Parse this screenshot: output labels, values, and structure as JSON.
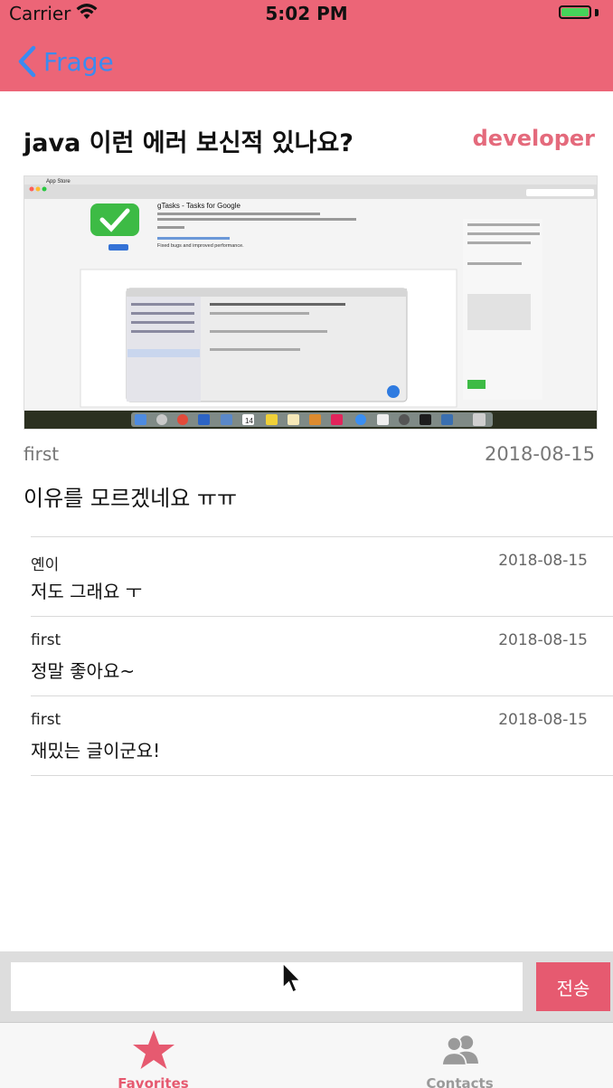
{
  "status_bar": {
    "carrier": "Carrier",
    "time": "5:02 PM",
    "battery_level": 1.0
  },
  "nav": {
    "back_label": "Frage"
  },
  "post": {
    "title": "java 이런 에러 보신적 있나요?",
    "badge": "developer",
    "author": "first",
    "date": "2018-08-15",
    "body": "이유를 모르겠네요 ㅠㅠ"
  },
  "screenshot": {
    "menubar_app": "App Store",
    "app_title": "gTasks - Tasks for Google",
    "app_note": "Fixed bugs and improved performance.",
    "dock_date": "14"
  },
  "comments": [
    {
      "author": "옌이",
      "date": "2018-08-15",
      "body": "저도 그래요 ㅜ"
    },
    {
      "author": "first",
      "date": "2018-08-15",
      "body": "정말 좋아요~"
    },
    {
      "author": "first",
      "date": "2018-08-15",
      "body": "재밌는 글이군요!"
    }
  ],
  "composer": {
    "value": "",
    "placeholder": "",
    "send_label": "전송"
  },
  "tabs": [
    {
      "label": "Favorites",
      "active": true
    },
    {
      "label": "Contacts",
      "active": false
    }
  ],
  "colors": {
    "accent": "#ec6577",
    "link": "#3b8bf0",
    "send": "#e65a70"
  }
}
